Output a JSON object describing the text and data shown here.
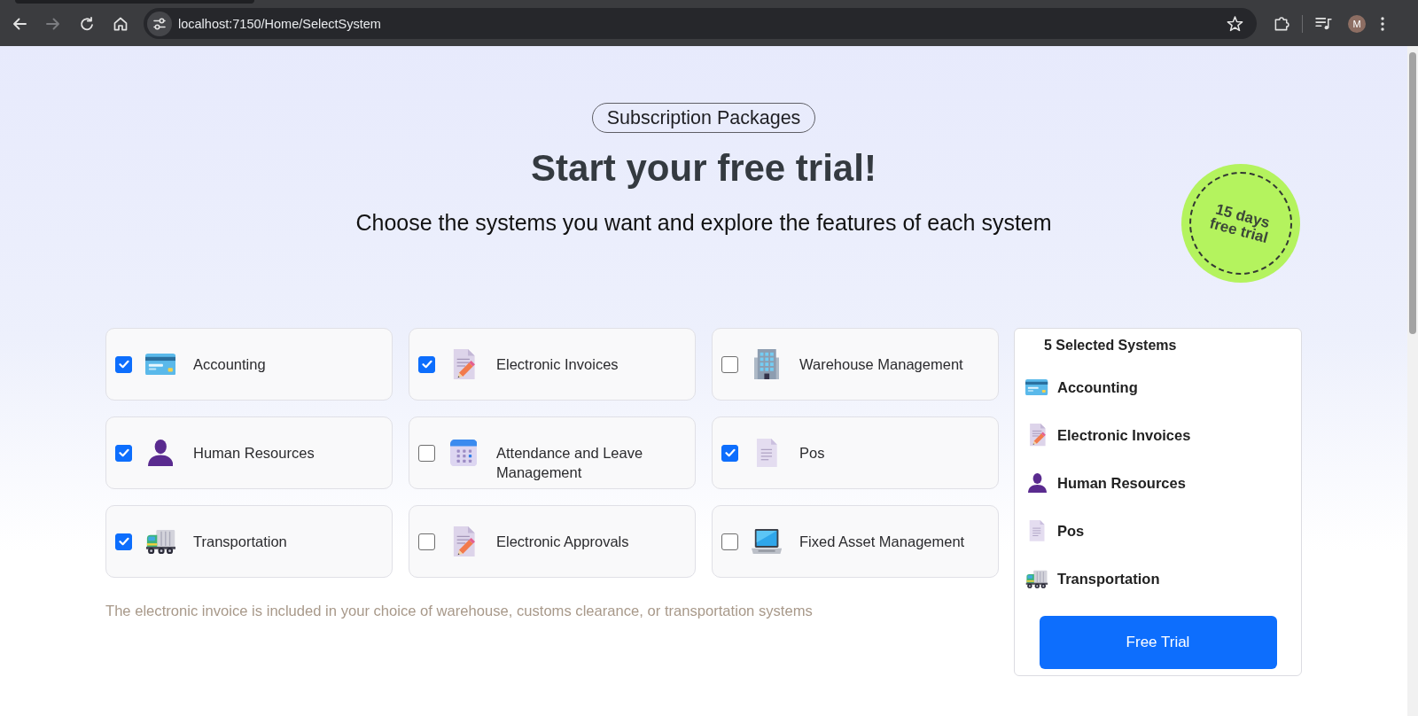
{
  "browser": {
    "nav": [
      {
        "kind": "back",
        "disabled": false
      },
      {
        "kind": "forward",
        "disabled": true
      },
      {
        "kind": "reload",
        "disabled": false
      },
      {
        "kind": "home",
        "disabled": false
      }
    ],
    "url": "localhost:7150/Home/SelectSystem",
    "avatar": "M"
  },
  "header": {
    "tag": "Subscription Packages",
    "title": "Start your free trial!",
    "subtitle": "Choose the systems you want and explore the features of each system",
    "badge": "15 days free trial"
  },
  "systems": [
    {
      "label": "Accounting",
      "kind": "card",
      "checked": true
    },
    {
      "label": "Electronic Invoices",
      "kind": "memo",
      "checked": true
    },
    {
      "label": "Warehouse Management",
      "kind": "building",
      "checked": false
    },
    {
      "label": "Human Resources",
      "kind": "person",
      "checked": true
    },
    {
      "label": "Attendance and Leave Management",
      "kind": "calendar",
      "checked": false
    },
    {
      "label": "Pos",
      "kind": "document",
      "checked": true
    },
    {
      "label": "Transportation",
      "kind": "truck",
      "checked": true
    },
    {
      "label": "Electronic Approvals",
      "kind": "memo",
      "checked": false
    },
    {
      "label": "Fixed Asset Management",
      "kind": "laptop",
      "checked": false
    }
  ],
  "note": "The electronic invoice is included in your choice of warehouse, customs clearance, or transportation systems",
  "summary": {
    "title": "5 Selected Systems",
    "items": [
      {
        "label": "Accounting",
        "kind": "card"
      },
      {
        "label": "Electronic Invoices",
        "kind": "memo"
      },
      {
        "label": "Human Resources",
        "kind": "person"
      },
      {
        "label": "Pos",
        "kind": "document"
      },
      {
        "label": "Transportation",
        "kind": "truck"
      }
    ],
    "button": "Free Trial"
  }
}
